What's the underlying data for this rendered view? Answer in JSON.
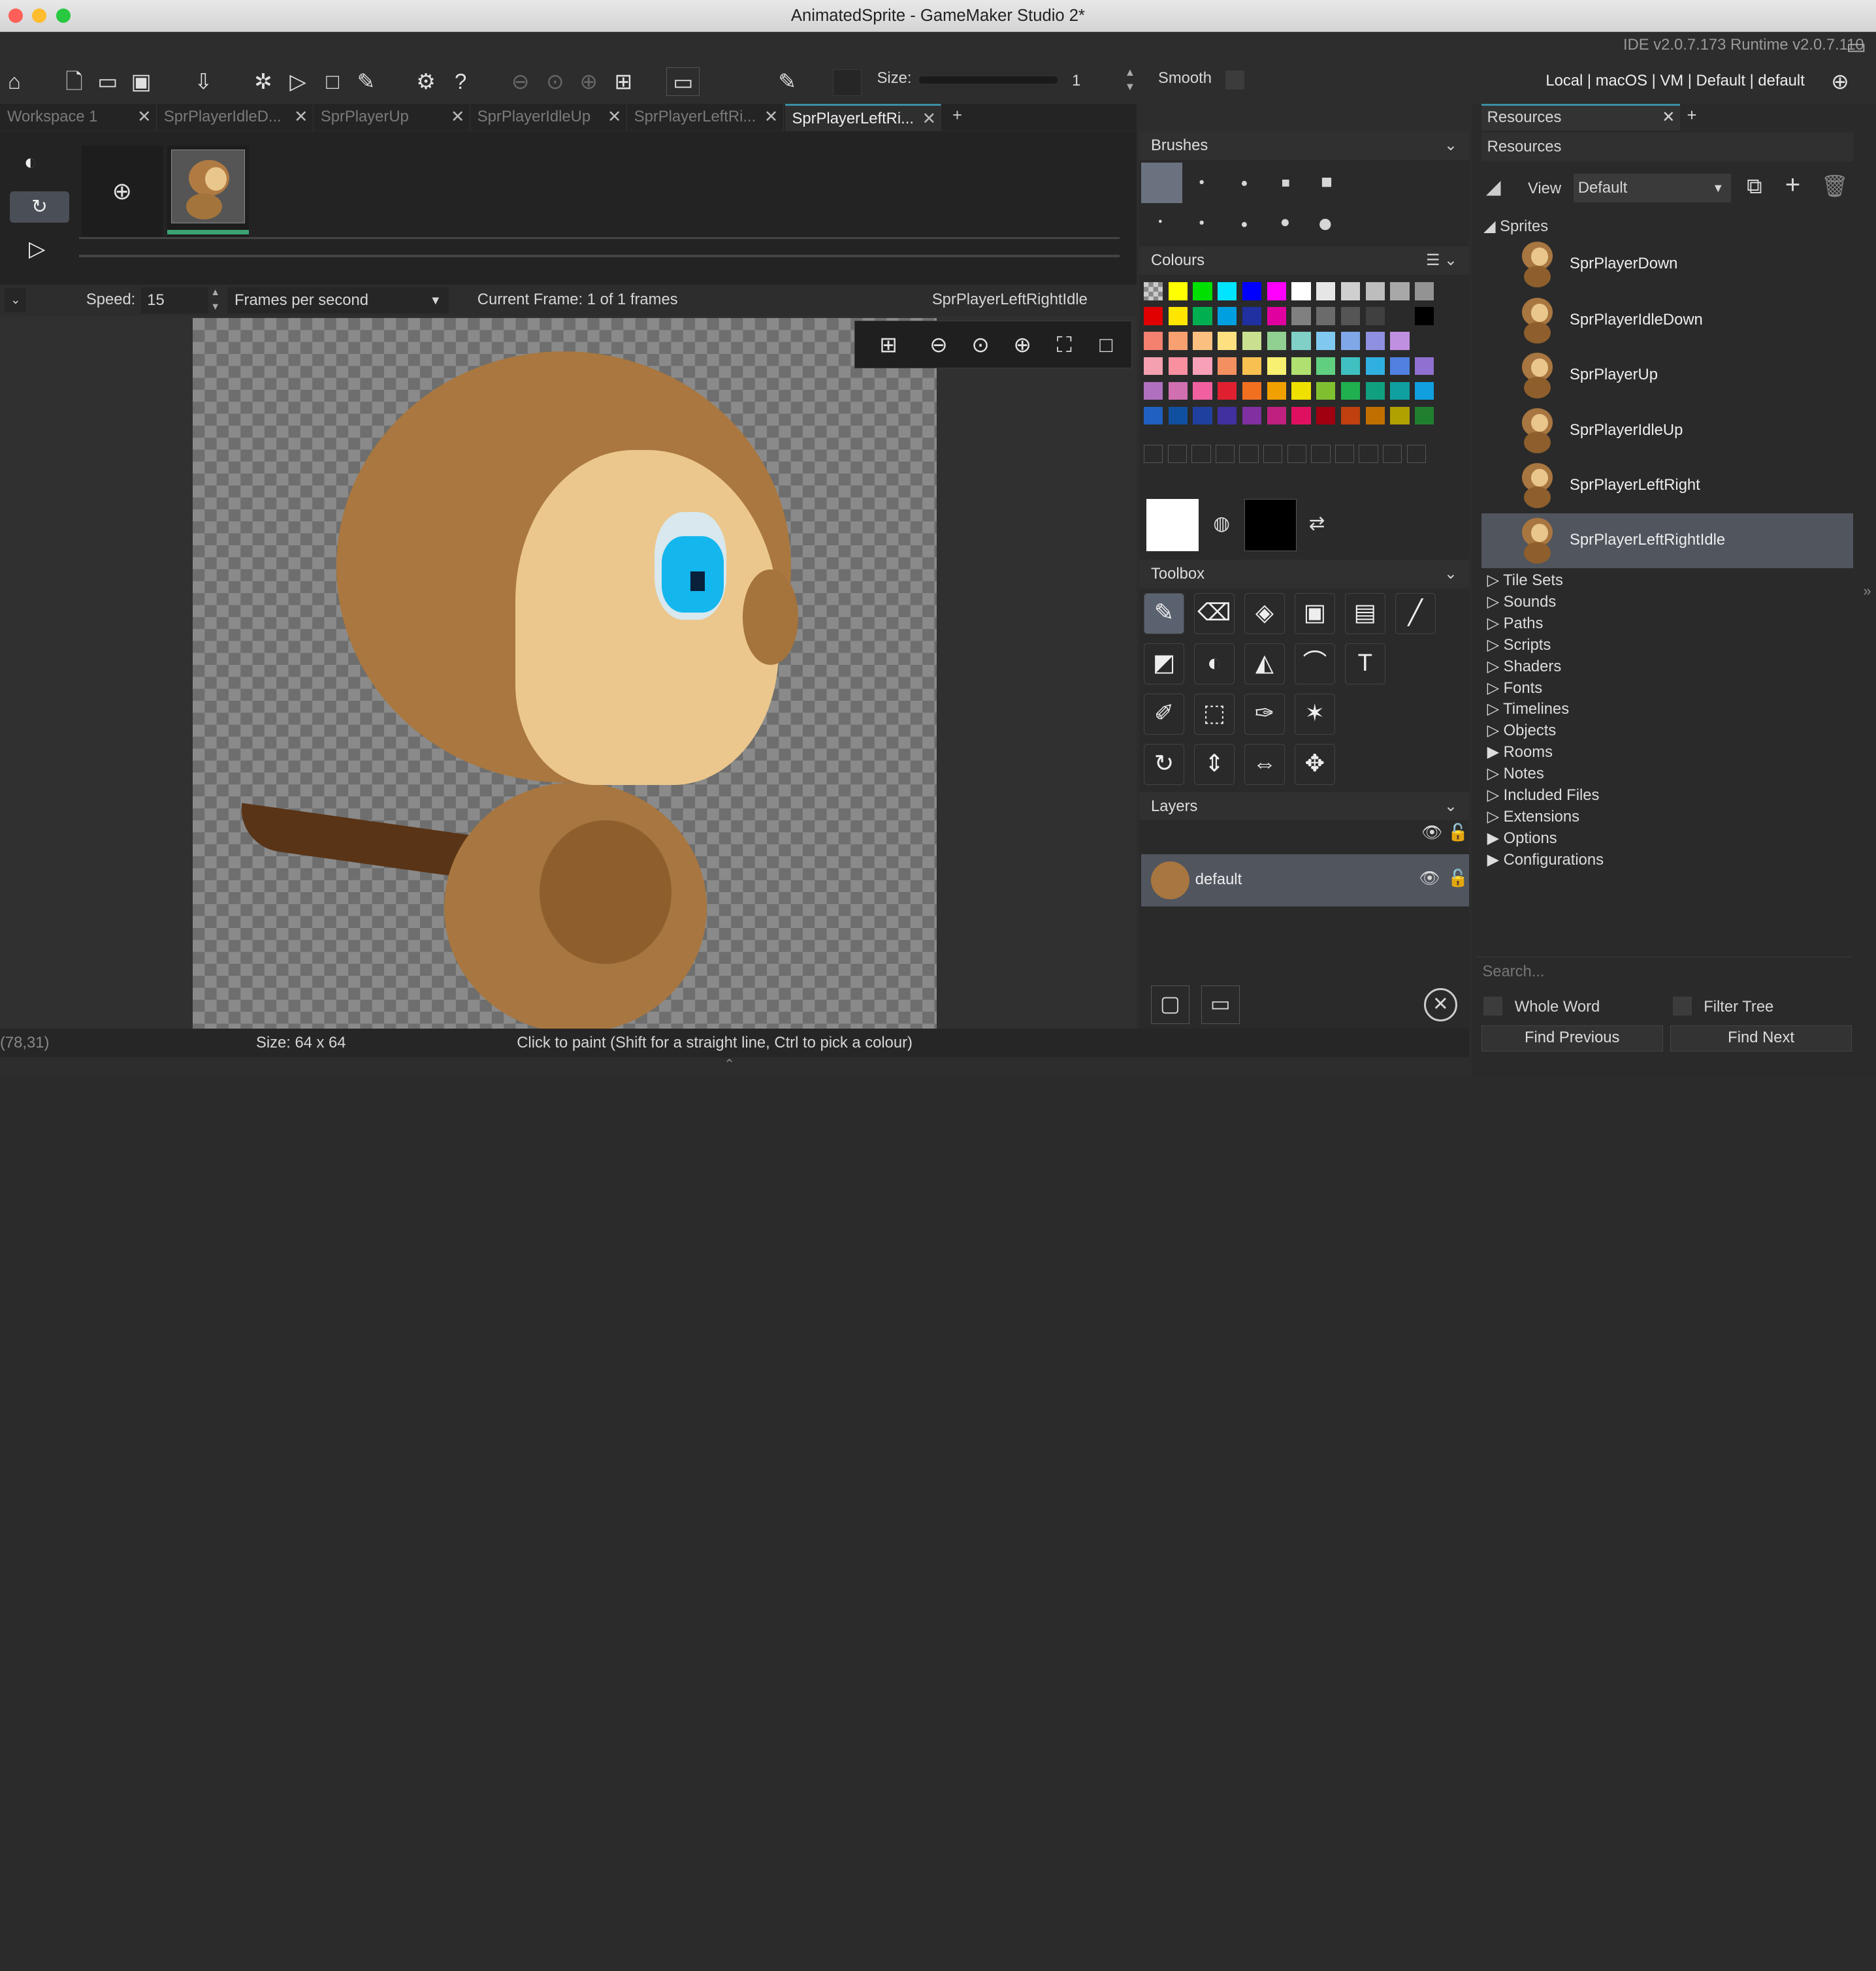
{
  "window": {
    "title": "AnimatedSprite - GameMaker Studio 2*",
    "ide_version": "IDE v2.0.7.173 Runtime v2.0.7.110"
  },
  "toolbar": {
    "size_label": "Size:",
    "size_value": "1",
    "smooth_label": "Smooth",
    "target": "Local | macOS | VM | Default | default"
  },
  "tabs": [
    {
      "label": "Workspace 1"
    },
    {
      "label": "SprPlayerIdleD..."
    },
    {
      "label": "SprPlayerUp"
    },
    {
      "label": "SprPlayerIdleUp"
    },
    {
      "label": "SprPlayerLeftRi..."
    },
    {
      "label": "SprPlayerLeftRi..."
    }
  ],
  "resources_tab": {
    "label": "Resources",
    "plus": "+"
  },
  "frames_bar": {
    "speed_label": "Speed:",
    "speed_value": "15",
    "speed_unit": "Frames per second",
    "current_frame": "Current Frame: 1 of 1 frames",
    "sprite_name": "SprPlayerLeftRightIdle"
  },
  "panels": {
    "brushes": "Brushes",
    "colours": "Colours",
    "toolbox": "Toolbox",
    "layers": "Layers"
  },
  "layer": {
    "name": "default"
  },
  "status": {
    "coords": "(78,31)",
    "size": "Size: 64 x 64",
    "hint": "Click to paint (Shift for a straight line, Ctrl to pick a colour)"
  },
  "resources": {
    "header": "Resources",
    "view_label": "View",
    "view_value": "Default",
    "sprites_label": "Sprites",
    "sprites": [
      "SprPlayerDown",
      "SprPlayerIdleDown",
      "SprPlayerUp",
      "SprPlayerIdleUp",
      "SprPlayerLeftRight",
      "SprPlayerLeftRightIdle"
    ],
    "folders": [
      "Tile Sets",
      "Sounds",
      "Paths",
      "Scripts",
      "Shaders",
      "Fonts",
      "Timelines",
      "Objects",
      "Rooms",
      "Notes",
      "Included Files",
      "Extensions",
      "Options",
      "Configurations"
    ],
    "search_placeholder": "Search...",
    "whole_word": "Whole Word",
    "filter_tree": "Filter Tree",
    "find_previous": "Find Previous",
    "find_next": "Find Next"
  },
  "palette": {
    "row1": [
      "#ffff00",
      "#00e000",
      "#00e5ff",
      "#0000ff",
      "#ff00ff",
      "#ffffff",
      "#e6e6e6",
      "#cfcfcf",
      "#bdbdbd",
      "#a8a8a8",
      "#939393"
    ],
    "row2": [
      "#e00000",
      "#ffe600",
      "#00b050",
      "#00a0e0",
      "#2030a0",
      "#e000a0",
      "#808080",
      "#6b6b6b",
      "#555555",
      "#404040",
      "#2a2a2a",
      "#000000"
    ],
    "row3": [
      "#f48070",
      "#f8a070",
      "#fbc080",
      "#fde080",
      "#c8e090",
      "#90d090",
      "#80d0c8",
      "#80c8f0",
      "#80a8e8",
      "#9090e0",
      "#c090e0"
    ],
    "row4": [
      "#f4a0b0",
      "#f890a0",
      "#f8a0b8",
      "#f49060",
      "#f8c050",
      "#f8f070",
      "#b0e070",
      "#60d080",
      "#40c0c0",
      "#30b0e0",
      "#5080e0",
      "#9070d0"
    ],
    "row5": [
      "#b070c0",
      "#d070b0",
      "#f060a0",
      "#e02030",
      "#f07020",
      "#f0a000",
      "#f0e000",
      "#80c030",
      "#20b050",
      "#10a080",
      "#10a0a0",
      "#10a0e0"
    ],
    "row6": [
      "#2060c0",
      "#1050a0",
      "#2040a0",
      "#4030a0",
      "#8030a0",
      "#c02080",
      "#e01060",
      "#a00010",
      "#c04010",
      "#c07000",
      "#b0a000",
      "#208030"
    ]
  }
}
